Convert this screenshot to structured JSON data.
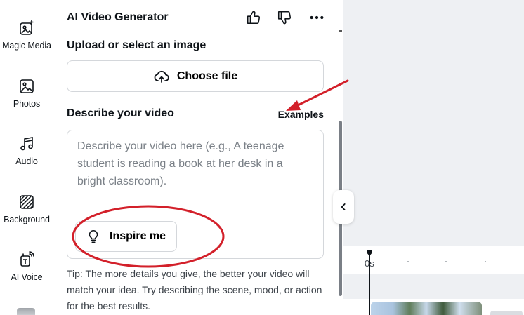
{
  "rail": {
    "items": [
      {
        "label": "Magic Media",
        "icon": "magic-media-icon"
      },
      {
        "label": "Photos",
        "icon": "photos-icon"
      },
      {
        "label": "Audio",
        "icon": "music-note-icon"
      },
      {
        "label": "Background",
        "icon": "background-pattern-icon"
      },
      {
        "label": "AI Voice",
        "icon": "ai-voice-icon"
      }
    ]
  },
  "panel": {
    "title": "AI Video Generator",
    "upload": {
      "label": "Upload or select an image",
      "button_label": "Choose file"
    },
    "describe": {
      "label": "Describe your video",
      "examples_label": "Examples",
      "value": "",
      "placeholder": "Describe your video here (e.g., A teenage student is reading a book at her desk in a bright classroom).",
      "inspire_label": "Inspire me"
    },
    "tip": "Tip: The more details you give, the better your video will match your idea. Try describing the scene, mood, or action for the best results."
  },
  "timeline": {
    "time_label": "0s"
  },
  "colors": {
    "annotation_red": "#d3202a",
    "border": "#d4d7db",
    "text": "#0e1318"
  }
}
